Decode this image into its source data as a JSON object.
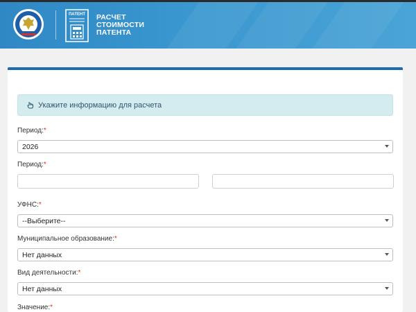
{
  "header": {
    "brand_lines": [
      "РАСЧЕТ",
      "СТОИМОСТИ",
      "ПАТЕНТА"
    ],
    "doc_icon_text": "ПАТЕНТ",
    "colors": {
      "header": "#3a97cf",
      "card_border": "#1e6bb0",
      "required": "#d9321e",
      "info_bg": "#d4ecef"
    }
  },
  "form": {
    "info_text": "Укажите информацию для расчета",
    "period1_label": "Период:",
    "period1_value": "2026",
    "period2_label": "Период:",
    "ufns_label": "УФНС:",
    "ufns_value": "--Выберите--",
    "municipality_label": "Муниципальное образование:",
    "municipality_value": "Нет данных",
    "activity_label": "Вид деятельности:",
    "activity_value": "Нет данных",
    "value_label": "Значение:",
    "required_mark": "*"
  }
}
